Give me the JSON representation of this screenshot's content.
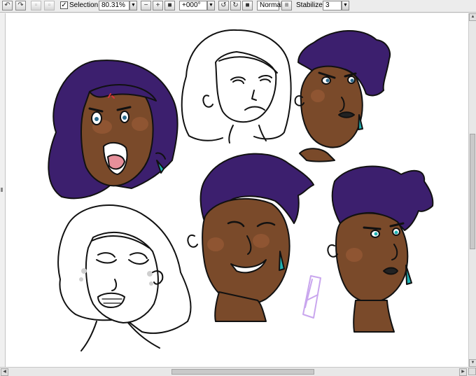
{
  "toolbar": {
    "undo_icon": "undo-icon",
    "redo_icon": "redo-icon",
    "selection_checked": true,
    "selection_label": "Selection",
    "zoom_value": "80.31%",
    "rotation_value": "+000°",
    "blend_mode": "Normal",
    "stabilizer_label": "Stabilizer",
    "stabilizer_value": "3"
  },
  "canvas": {
    "artwork": "character expression sketches",
    "signature_letter": "A"
  },
  "colors": {
    "hair": "#3c1f6e",
    "skin": "#7a4a2a",
    "blush": "#8f5532",
    "earring": "#1fb3b3",
    "signature": "#c9a6ee"
  }
}
